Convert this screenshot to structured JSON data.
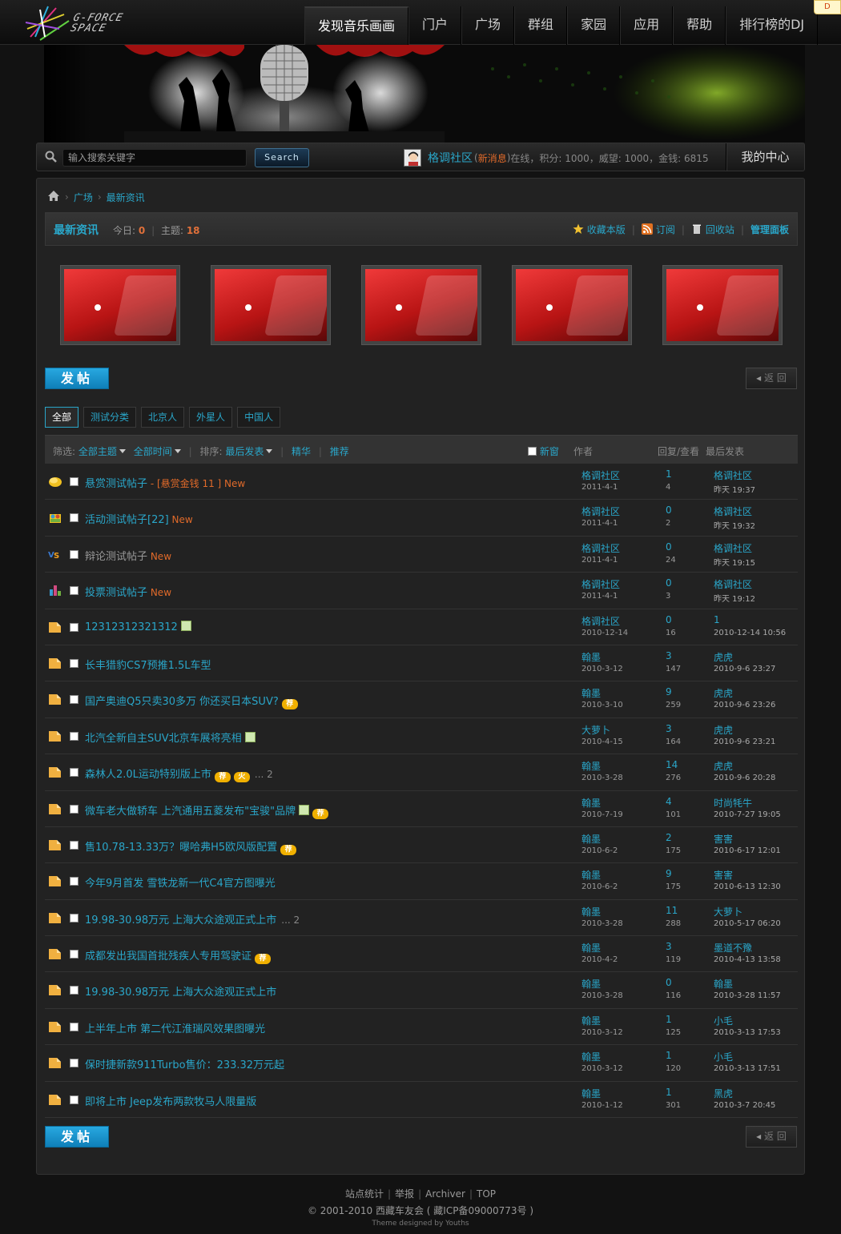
{
  "nav": {
    "items": [
      "发现音乐画画",
      "门户",
      "广场",
      "群组",
      "家园",
      "应用",
      "帮助",
      "排行榜的DJ"
    ]
  },
  "corner_tag": "D",
  "search": {
    "placeholder": "输入搜索关键字",
    "button": "Search"
  },
  "user": {
    "name": "格调社区",
    "msg": "新消息",
    "status": "在线，积分: 1000，威望: 1000，金钱: 6815",
    "center": "我的中心"
  },
  "breadcrumb": [
    "广场",
    "最新资讯"
  ],
  "forum": {
    "title": "最新资讯",
    "today_label": "今日:",
    "today": "0",
    "topics_label": "主题:",
    "topics": "18",
    "tools": [
      "收藏本版",
      "订阅",
      "回收站",
      "管理面板"
    ]
  },
  "buttons": {
    "post": "发帖",
    "back": "返 回"
  },
  "filters": [
    "全部",
    "测试分类",
    "北京人",
    "外星人",
    "中国人"
  ],
  "listhead": {
    "filter_label": "筛选:",
    "all_topics": "全部主题",
    "all_time": "全部时间",
    "sort_label": "排序:",
    "sort_value": "最后发表",
    "digest": "精华",
    "recommend": "推荐",
    "new_window": "新窗",
    "author": "作者",
    "reply_view": "回复/查看",
    "last_post": "最后发表"
  },
  "threads": [
    {
      "icon": "reward",
      "title": "悬赏测试帖子",
      "extra": " - [悬赏金钱 11 ] New",
      "author": "格调社区",
      "date": "2011-4-1",
      "replies": "1",
      "views": "4",
      "last": "格调社区",
      "ldate": "昨天 19:37"
    },
    {
      "icon": "activity",
      "title": "活动测试帖子[22]",
      "extra": " New",
      "author": "格调社区",
      "date": "2011-4-1",
      "replies": "0",
      "views": "2",
      "last": "格调社区",
      "ldate": "昨天 19:32"
    },
    {
      "icon": "debate",
      "title": "辩论测试帖子",
      "extra": " New",
      "grey": true,
      "author": "格调社区",
      "date": "2011-4-1",
      "replies": "0",
      "views": "24",
      "last": "格调社区",
      "ldate": "昨天 19:15"
    },
    {
      "icon": "poll",
      "title": "投票测试帖子",
      "extra": " New",
      "author": "格调社区",
      "date": "2011-4-1",
      "replies": "0",
      "views": "3",
      "last": "格调社区",
      "ldate": "昨天 19:12"
    },
    {
      "icon": "folder",
      "title": "12312312321312",
      "attach": true,
      "author": "格调社区",
      "date": "2010-12-14",
      "replies": "0",
      "views": "16",
      "last": "1",
      "ldate": "2010-12-14 10:56"
    },
    {
      "icon": "folder",
      "title": "长丰猎豹CS7预推1.5L车型",
      "author": "翰墨",
      "date": "2010-3-12",
      "replies": "3",
      "views": "147",
      "last": "虎虎",
      "ldate": "2010-9-6 23:27"
    },
    {
      "icon": "folder",
      "title": "国产奥迪Q5只卖30多万 你还买日本SUV?",
      "badges": [
        "荐"
      ],
      "author": "翰墨",
      "date": "2010-3-10",
      "replies": "9",
      "views": "259",
      "last": "虎虎",
      "ldate": "2010-9-6 23:26"
    },
    {
      "icon": "folder",
      "title": "北汽全新自主SUV北京车展将亮相",
      "attach": true,
      "author": "大萝卜",
      "date": "2010-4-15",
      "replies": "3",
      "views": "164",
      "last": "虎虎",
      "ldate": "2010-9-6 23:21"
    },
    {
      "icon": "folder",
      "title": "森林人2.0L运动特别版上市",
      "badges": [
        "荐",
        "火"
      ],
      "pages": "... 2",
      "author": "翰墨",
      "date": "2010-3-28",
      "replies": "14",
      "views": "276",
      "last": "虎虎",
      "ldate": "2010-9-6 20:28"
    },
    {
      "icon": "folder",
      "title": "微车老大做轿车 上汽通用五菱发布\"宝骏\"品牌",
      "attach": true,
      "badges": [
        "荐"
      ],
      "author": "翰墨",
      "date": "2010-7-19",
      "replies": "4",
      "views": "101",
      "last": "时尚牦牛",
      "ldate": "2010-7-27 19:05"
    },
    {
      "icon": "folder",
      "title": "售10.78-13.33万？曝哈弗H5欧风版配置",
      "badges": [
        "荐"
      ],
      "author": "翰墨",
      "date": "2010-6-2",
      "replies": "2",
      "views": "175",
      "last": "害害",
      "ldate": "2010-6-17 12:01"
    },
    {
      "icon": "folder",
      "title": "今年9月首发 雪铁龙新一代C4官方图曝光",
      "author": "翰墨",
      "date": "2010-6-2",
      "replies": "9",
      "views": "175",
      "last": "害害",
      "ldate": "2010-6-13 12:30"
    },
    {
      "icon": "folder",
      "title": "19.98-30.98万元 上海大众途观正式上市",
      "pages": "... 2",
      "author": "翰墨",
      "date": "2010-3-28",
      "replies": "11",
      "views": "288",
      "last": "大萝卜",
      "ldate": "2010-5-17 06:20"
    },
    {
      "icon": "folder",
      "title": "成都发出我国首批残疾人专用驾驶证",
      "badges": [
        "荐"
      ],
      "author": "翰墨",
      "date": "2010-4-2",
      "replies": "3",
      "views": "119",
      "last": "墨道不豫",
      "ldate": "2010-4-13 13:58"
    },
    {
      "icon": "folder",
      "title": "19.98-30.98万元 上海大众途观正式上市",
      "author": "翰墨",
      "date": "2010-3-28",
      "replies": "0",
      "views": "116",
      "last": "翰墨",
      "ldate": "2010-3-28 11:57"
    },
    {
      "icon": "folder",
      "title": "上半年上市 第二代江淮瑞风效果图曝光",
      "author": "翰墨",
      "date": "2010-3-12",
      "replies": "1",
      "views": "125",
      "last": "小毛",
      "ldate": "2010-3-13 17:53"
    },
    {
      "icon": "folder",
      "title": "保时捷新款911Turbo售价：233.32万元起",
      "author": "翰墨",
      "date": "2010-3-12",
      "replies": "1",
      "views": "120",
      "last": "小毛",
      "ldate": "2010-3-13 17:51"
    },
    {
      "icon": "folder",
      "title": "即将上市 Jeep发布两款牧马人限量版",
      "author": "翰墨",
      "date": "2010-1-12",
      "replies": "1",
      "views": "301",
      "last": "黑虎",
      "ldate": "2010-3-7 20:45"
    }
  ],
  "footer": {
    "links": [
      "站点统计",
      "举报",
      "Archiver",
      "TOP"
    ],
    "copyright": "© 2001-2010 西藏车友会 ( 藏ICP备09000773号 )",
    "design": "Theme designed by Youths"
  },
  "colors": {
    "link": "#2aa6c9",
    "accent": "#e06a2a",
    "post_button": "#1a95d0"
  }
}
